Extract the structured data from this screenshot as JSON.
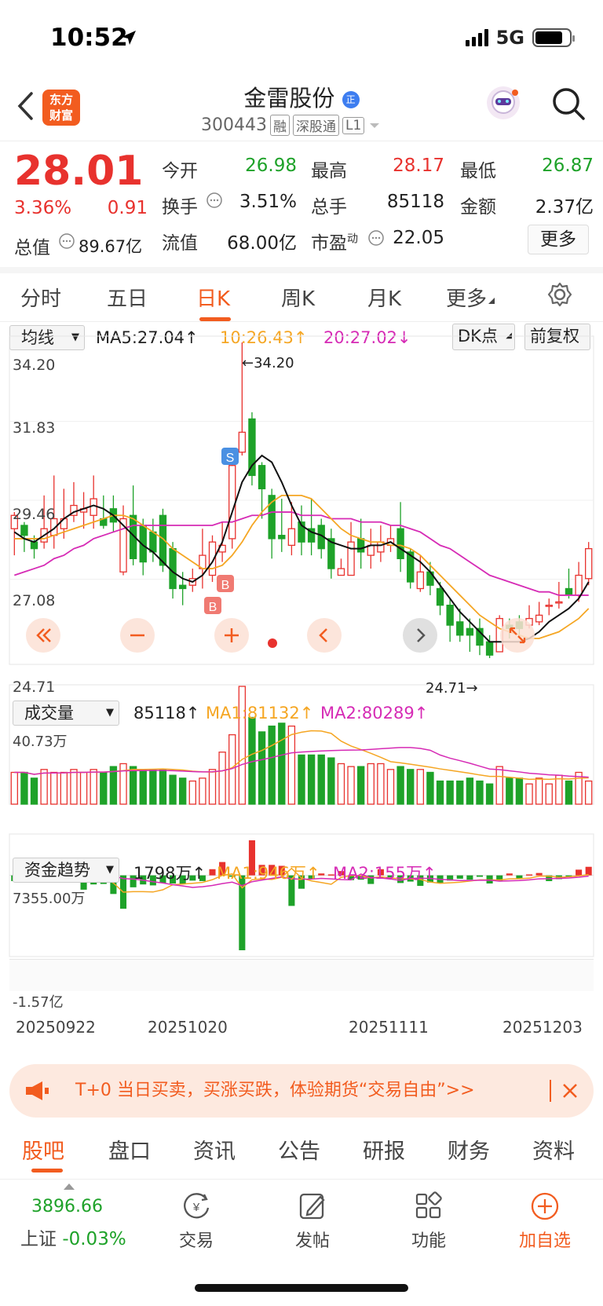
{
  "status": {
    "time": "10:52",
    "network": "5G"
  },
  "header": {
    "logo": "东方\n财富",
    "name": "金雷股份",
    "name_badge": "正",
    "code": "300443",
    "tags": [
      "融",
      "深股通",
      "L1"
    ]
  },
  "quote": {
    "price": "28.01",
    "change_pct": "3.36%",
    "change": "0.91",
    "open_label": "今开",
    "open": "26.98",
    "high_label": "最高",
    "high": "28.17",
    "low_label": "最低",
    "low": "26.87",
    "turnover_label": "换手",
    "turnover": "3.51%",
    "vol_label": "总手",
    "vol": "85118",
    "amount_label": "金额",
    "amount": "2.37亿",
    "mcap_label": "总值",
    "mcap": "89.67亿",
    "float_label": "流值",
    "float": "68.00亿",
    "pe_label": "市盈",
    "pe_sup": "动",
    "pe": "22.05",
    "more": "更多"
  },
  "tabs": [
    {
      "label": "分时"
    },
    {
      "label": "五日"
    },
    {
      "label": "日K"
    },
    {
      "label": "周K"
    },
    {
      "label": "月K"
    },
    {
      "label": "更多"
    }
  ],
  "kline": {
    "selector": "均线",
    "ma5": "MA5:27.04↑",
    "ma10": "10:26.43↑",
    "ma20": "20:27.02↓",
    "dk": "DK点",
    "adj": "前复权",
    "y_labels": [
      "34.20",
      "31.83",
      "29.46",
      "27.08",
      "24.71"
    ],
    "max_label": "←34.20",
    "min_label": "24.71→"
  },
  "volume": {
    "selector": "成交量",
    "value": "85118↑",
    "ma1": "MA1:81132↑",
    "ma2": "MA2:80289↑",
    "max_label": "40.73万"
  },
  "funds": {
    "selector": "资金趋势",
    "value": "1798万↑",
    "ma1": "MA1:946万↑",
    "ma2": "MA2:155万↑",
    "max_label": "7355.00万",
    "min_label": "-1.57亿"
  },
  "x_dates": [
    "20250922",
    "20251020",
    "20251111",
    "20251203"
  ],
  "banner": {
    "text": "T+0 当日买卖，买涨买跌，体验期货“交易自由”>>"
  },
  "bottom_tabs": [
    "股吧",
    "盘口",
    "资讯",
    "公告",
    "研报",
    "财务",
    "资料"
  ],
  "bottom_bar": {
    "index_value": "3896.66",
    "index_name": "上证",
    "index_change": "-0.03%",
    "trade": "交易",
    "post": "发帖",
    "func": "功能",
    "add": "加自选"
  },
  "colors": {
    "up": "#e8322e",
    "down": "#1ea229",
    "accent": "#f25c1f",
    "ma5": "#111111",
    "ma10": "#f5a623",
    "ma20": "#d62bb5"
  },
  "chart_data": {
    "type": "candlestick",
    "ylim": [
      24.71,
      34.2
    ],
    "candles": [
      [
        28.6,
        29.0,
        29.1,
        27.8
      ],
      [
        28.7,
        28.4,
        28.8,
        27.9
      ],
      [
        28.2,
        28.0,
        28.4,
        27.7
      ],
      [
        28.2,
        28.6,
        29.6,
        28.0
      ],
      [
        28.4,
        28.9,
        30.2,
        28.0
      ],
      [
        28.6,
        28.9,
        29.8,
        28.3
      ],
      [
        29.0,
        29.3,
        30.0,
        28.8
      ],
      [
        29.1,
        29.2,
        29.7,
        28.6
      ],
      [
        29.0,
        29.5,
        30.2,
        28.6
      ],
      [
        28.9,
        28.7,
        29.6,
        28.6
      ],
      [
        29.2,
        28.8,
        29.6,
        28.5
      ],
      [
        27.3,
        28.9,
        29.3,
        27.2
      ],
      [
        29.0,
        27.7,
        29.9,
        27.5
      ],
      [
        28.7,
        27.6,
        28.9,
        27.2
      ],
      [
        28.5,
        27.9,
        28.9,
        27.6
      ],
      [
        29.0,
        27.5,
        29.2,
        27.3
      ],
      [
        28.0,
        26.8,
        28.2,
        26.5
      ],
      [
        26.9,
        26.8,
        27.3,
        26.3
      ],
      [
        26.9,
        27.1,
        27.4,
        26.7
      ],
      [
        27.4,
        27.8,
        28.6,
        26.8
      ],
      [
        27.2,
        28.2,
        28.4,
        27.0
      ],
      [
        27.9,
        28.1,
        28.8,
        27.6
      ],
      [
        28.3,
        30.5,
        30.7,
        28.0
      ],
      [
        30.9,
        31.5,
        34.2,
        30.8
      ],
      [
        31.9,
        30.2,
        32.1,
        29.9
      ],
      [
        30.5,
        29.8,
        30.6,
        28.9
      ],
      [
        29.6,
        28.3,
        29.8,
        27.7
      ],
      [
        28.4,
        28.3,
        29.5,
        27.9
      ],
      [
        28.1,
        28.6,
        29.4,
        27.8
      ],
      [
        28.8,
        28.2,
        29.3,
        27.8
      ],
      [
        28.6,
        28.2,
        29.5,
        27.8
      ],
      [
        28.7,
        28.0,
        28.9,
        27.7
      ],
      [
        28.3,
        27.4,
        28.6,
        27.1
      ],
      [
        27.2,
        27.4,
        27.7,
        27.2
      ],
      [
        27.2,
        28.2,
        28.8,
        27.3
      ],
      [
        28.3,
        27.9,
        28.9,
        27.4
      ],
      [
        27.8,
        28.1,
        28.6,
        27.4
      ],
      [
        27.9,
        28.2,
        28.7,
        27.6
      ],
      [
        28.1,
        28.3,
        28.7,
        27.9
      ],
      [
        28.6,
        27.7,
        29.4,
        27.3
      ],
      [
        27.9,
        27.0,
        28.0,
        26.8
      ],
      [
        26.8,
        27.3,
        27.8,
        26.7
      ],
      [
        27.3,
        26.9,
        27.6,
        26.6
      ],
      [
        26.8,
        26.3,
        27.0,
        26.0
      ],
      [
        26.3,
        25.7,
        26.5,
        25.2
      ],
      [
        25.8,
        25.4,
        26.2,
        25.2
      ],
      [
        25.6,
        25.4,
        25.9,
        24.9
      ],
      [
        25.6,
        25.1,
        25.9,
        24.8
      ],
      [
        25.2,
        24.8,
        25.4,
        24.71
      ],
      [
        24.9,
        25.9,
        26.0,
        24.9
      ],
      [
        25.7,
        25.6,
        25.9,
        25.3
      ],
      [
        25.8,
        25.6,
        26.0,
        25.3
      ],
      [
        25.7,
        25.9,
        26.3,
        25.6
      ],
      [
        25.8,
        26.0,
        26.4,
        25.7
      ],
      [
        26.3,
        26.3,
        26.5,
        26.0
      ],
      [
        26.4,
        26.4,
        27.0,
        26.2
      ],
      [
        26.8,
        26.6,
        27.4,
        26.5
      ],
      [
        26.6,
        27.2,
        27.6,
        26.4
      ],
      [
        27.1,
        28.0,
        28.2,
        26.9
      ]
    ],
    "ma5": [
      28.5,
      28.3,
      28.2,
      28.4,
      28.6,
      28.9,
      29.1,
      29.2,
      29.3,
      29.2,
      29.0,
      28.7,
      28.4,
      28.1,
      27.9,
      27.6,
      27.3,
      27.1,
      27.0,
      27.2,
      27.6,
      28.2,
      29.1,
      30.0,
      30.5,
      30.8,
      30.6,
      30.0,
      29.3,
      28.7,
      28.5,
      28.4,
      28.2,
      28.1,
      28.0,
      28.0,
      28.1,
      28.1,
      28.2,
      28.0,
      27.8,
      27.6,
      27.3,
      26.9,
      26.5,
      26.1,
      25.8,
      25.5,
      25.2,
      25.2,
      25.2,
      25.2,
      25.3,
      25.5,
      25.8,
      26.0,
      26.2,
      26.5,
      27.0
    ],
    "ma10": [
      28.3,
      28.3,
      28.3,
      28.3,
      28.4,
      28.5,
      28.6,
      28.7,
      28.8,
      28.9,
      29.0,
      29.0,
      28.9,
      28.7,
      28.5,
      28.3,
      28.0,
      27.8,
      27.6,
      27.4,
      27.4,
      27.5,
      27.8,
      28.2,
      28.7,
      29.1,
      29.4,
      29.6,
      29.6,
      29.6,
      29.5,
      29.2,
      28.9,
      28.6,
      28.4,
      28.3,
      28.2,
      28.2,
      28.1,
      28.1,
      28.0,
      27.8,
      27.5,
      27.2,
      26.9,
      26.6,
      26.3,
      26.0,
      25.8,
      25.6,
      25.5,
      25.4,
      25.3,
      25.3,
      25.4,
      25.5,
      25.7,
      25.9,
      26.2
    ],
    "ma20": [
      27.2,
      27.3,
      27.4,
      27.5,
      27.7,
      27.8,
      28.0,
      28.1,
      28.3,
      28.4,
      28.5,
      28.6,
      28.7,
      28.7,
      28.7,
      28.7,
      28.7,
      28.7,
      28.7,
      28.7,
      28.7,
      28.8,
      28.8,
      28.9,
      29.0,
      29.0,
      29.1,
      29.1,
      29.1,
      29.0,
      29.0,
      29.0,
      28.9,
      28.9,
      28.9,
      28.8,
      28.8,
      28.8,
      28.7,
      28.7,
      28.6,
      28.5,
      28.3,
      28.1,
      28.0,
      27.8,
      27.6,
      27.4,
      27.2,
      27.1,
      27.0,
      26.9,
      26.8,
      26.7,
      26.7,
      26.6,
      26.6,
      26.6,
      26.6
    ],
    "volume": [
      11,
      11,
      9,
      12,
      11,
      11,
      12,
      11,
      12,
      11,
      13,
      14,
      13,
      12,
      12,
      12,
      10,
      9,
      8,
      9,
      12,
      18,
      24,
      40.73,
      30,
      25,
      27,
      28,
      27,
      17,
      17,
      17,
      16,
      14,
      13,
      13,
      14,
      14,
      12,
      13,
      12,
      12,
      11,
      8,
      8,
      8,
      9,
      8,
      7,
      13,
      9,
      9,
      7,
      9,
      7,
      10,
      8,
      11,
      8
    ],
    "funds": [
      -1200,
      800,
      1800,
      1600,
      2400,
      1500,
      2600,
      -3000,
      -1900,
      -1800,
      -3900,
      -7000,
      -2500,
      -1900,
      -2100,
      -1600,
      -1700,
      -1800,
      -1100,
      -1200,
      1300,
      2800,
      -300,
      -15700,
      7355,
      2200,
      2200,
      2000,
      -6400,
      -2800,
      -700,
      400,
      200,
      900,
      -1000,
      -900,
      -1800,
      1300,
      -400,
      -1600,
      -1300,
      -2200,
      -1500,
      -1700,
      -1100,
      -700,
      -900,
      -300,
      -1700,
      -1200,
      400,
      -700,
      200,
      500,
      -1200,
      -800,
      -200,
      1200,
      1798
    ],
    "x_labels": [
      "20250922",
      "20251020",
      "20251111",
      "20251203"
    ]
  }
}
